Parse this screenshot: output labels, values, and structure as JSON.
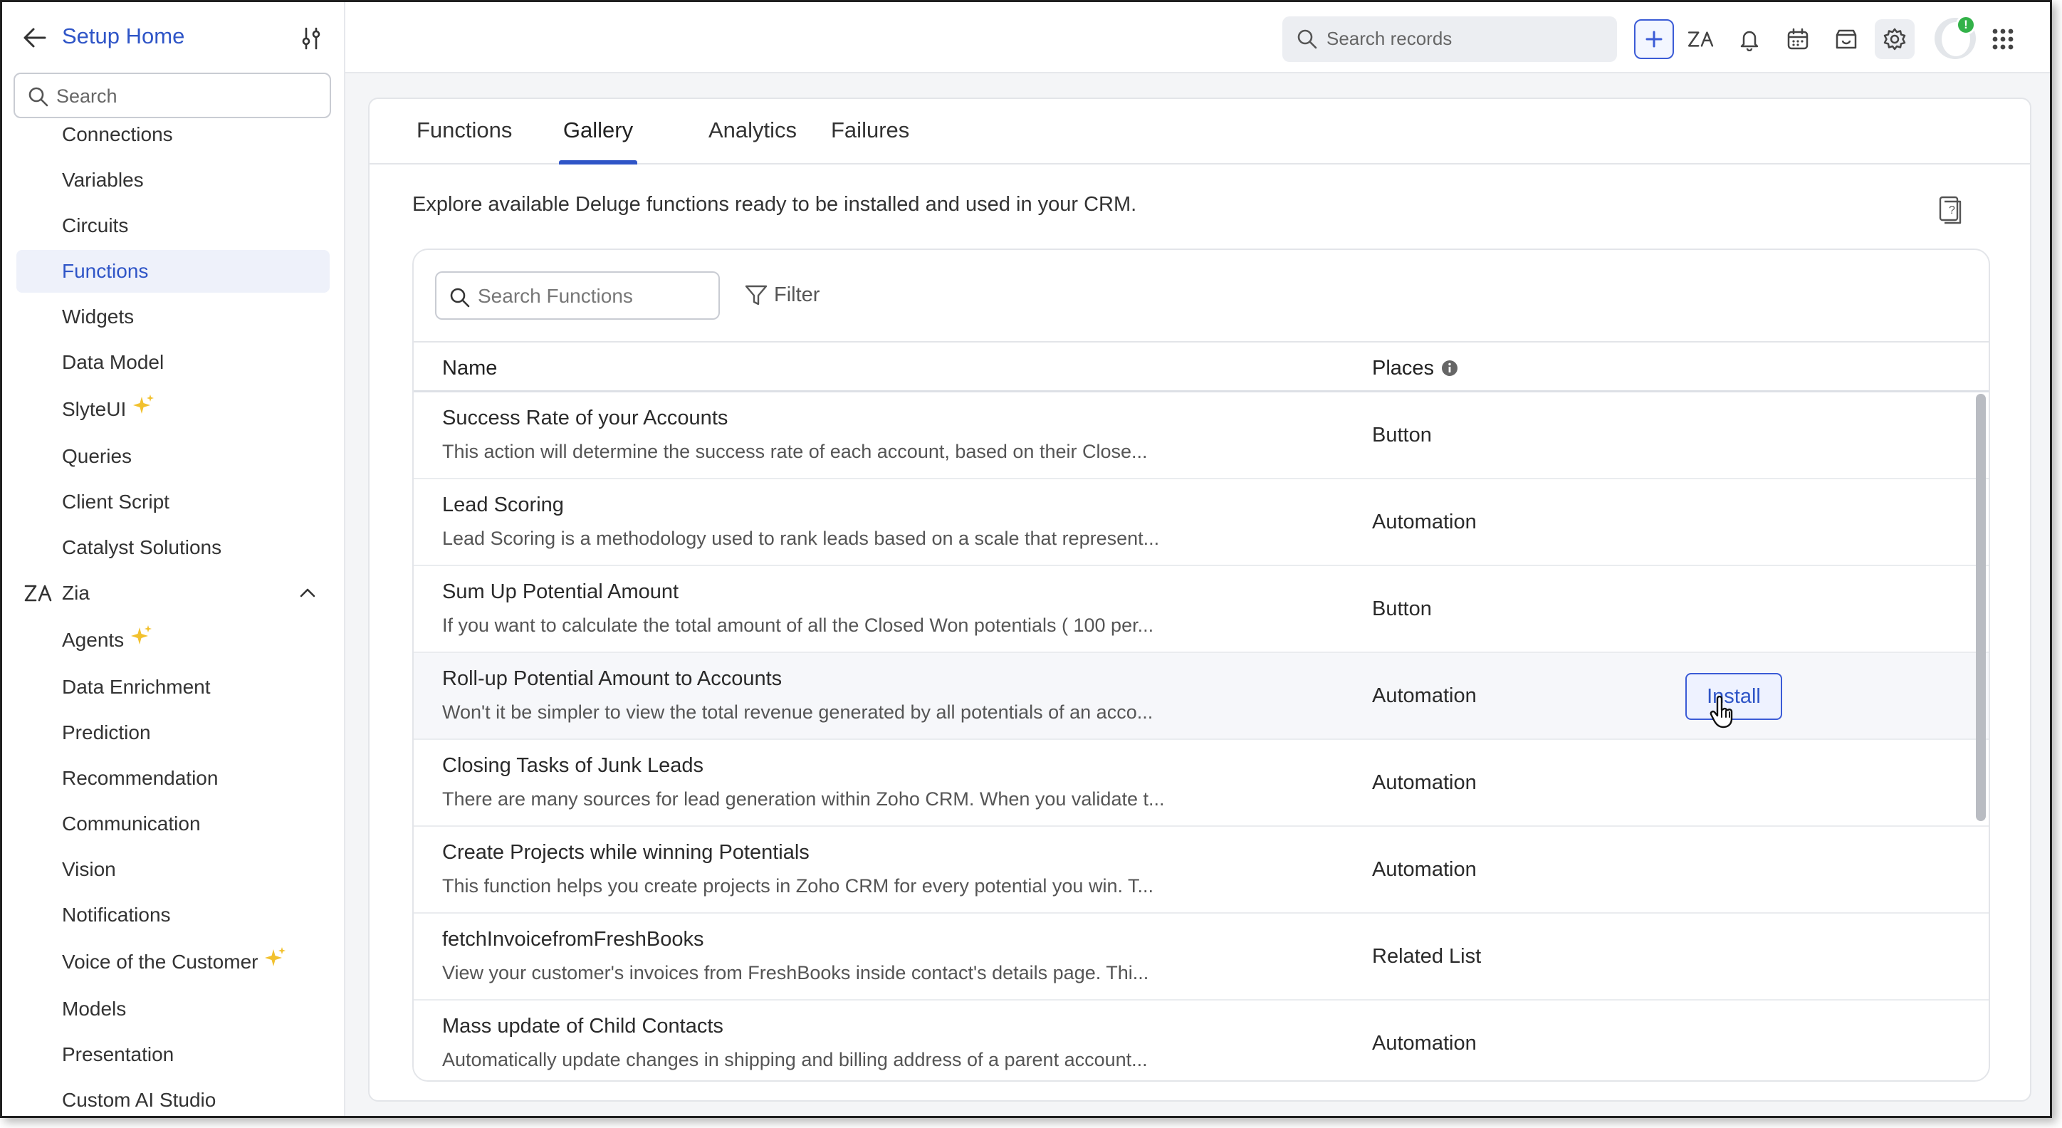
{
  "sidebar": {
    "title": "Setup Home",
    "search_placeholder": "Search",
    "items": [
      {
        "label": "Connections",
        "name": "sidebar-item-connections",
        "active": false
      },
      {
        "label": "Variables",
        "name": "sidebar-item-variables",
        "active": false
      },
      {
        "label": "Circuits",
        "name": "sidebar-item-circuits",
        "active": false
      },
      {
        "label": "Functions",
        "name": "sidebar-item-functions",
        "active": true
      },
      {
        "label": "Widgets",
        "name": "sidebar-item-widgets",
        "active": false
      },
      {
        "label": "Data Model",
        "name": "sidebar-item-data-model",
        "active": false
      },
      {
        "label": "SlyteUI",
        "name": "sidebar-item-slyteui",
        "active": false,
        "sparkle": true
      },
      {
        "label": "Queries",
        "name": "sidebar-item-queries",
        "active": false
      },
      {
        "label": "Client Script",
        "name": "sidebar-item-client-script",
        "active": false
      },
      {
        "label": "Catalyst Solutions",
        "name": "sidebar-item-catalyst-solutions",
        "active": false
      }
    ],
    "zia_section": {
      "label": "Zia",
      "expanded": true
    },
    "zia_items": [
      {
        "label": "Agents",
        "name": "sidebar-item-agents",
        "sparkle": true
      },
      {
        "label": "Data Enrichment",
        "name": "sidebar-item-data-enrichment"
      },
      {
        "label": "Prediction",
        "name": "sidebar-item-prediction"
      },
      {
        "label": "Recommendation",
        "name": "sidebar-item-recommendation"
      },
      {
        "label": "Communication",
        "name": "sidebar-item-communication"
      },
      {
        "label": "Vision",
        "name": "sidebar-item-vision"
      },
      {
        "label": "Notifications",
        "name": "sidebar-item-notifications"
      },
      {
        "label": "Voice of the Customer",
        "name": "sidebar-item-voice-of-the-customer",
        "sparkle": true
      },
      {
        "label": "Models",
        "name": "sidebar-item-models"
      },
      {
        "label": "Presentation",
        "name": "sidebar-item-presentation"
      },
      {
        "label": "Custom AI Studio",
        "name": "sidebar-item-custom-ai-studio"
      }
    ]
  },
  "topbar": {
    "search_placeholder": "Search records",
    "icons": [
      "plus-icon",
      "zia-icon",
      "bell-icon",
      "calendar-icon",
      "marketplace-icon",
      "gear-icon",
      "avatar",
      "apps-grid-icon"
    ],
    "notification_badge": "!"
  },
  "tabs": [
    {
      "label": "Functions",
      "active": false
    },
    {
      "label": "Gallery",
      "active": true
    },
    {
      "label": "Analytics",
      "active": false
    },
    {
      "label": "Failures",
      "active": false
    }
  ],
  "gallery": {
    "intro": "Explore available Deluge functions ready to be installed and used in your CRM.",
    "search_placeholder": "Search Functions",
    "filter_label": "Filter",
    "columns": {
      "name": "Name",
      "places": "Places"
    },
    "rows": [
      {
        "name": "Success Rate of your Accounts",
        "desc": "This action will determine the success rate of each account, based on their Close...",
        "place": "Button"
      },
      {
        "name": "Lead Scoring",
        "desc": "Lead Scoring is a methodology used to rank leads based on a scale that represent...",
        "place": "Automation"
      },
      {
        "name": "Sum Up Potential Amount",
        "desc": "If you want to calculate the total amount of all the Closed Won potentials ( 100 per...",
        "place": "Button"
      },
      {
        "name": "Roll-up Potential Amount to Accounts",
        "desc": "Won't it be simpler to view the total revenue generated by all potentials of an acco...",
        "place": "Automation",
        "install": "Install"
      },
      {
        "name": "Closing Tasks of Junk Leads",
        "desc": "There are many sources for lead generation within Zoho CRM. When you validate t...",
        "place": "Automation"
      },
      {
        "name": "Create Projects while winning Potentials",
        "desc": "This function helps you create projects in Zoho CRM for every potential you win. T...",
        "place": "Automation"
      },
      {
        "name": "fetchInvoicefromFreshBooks",
        "desc": "View your customer's invoices from FreshBooks inside contact's details page. Thi...",
        "place": "Related List"
      },
      {
        "name": "Mass update of Child Contacts",
        "desc": "Automatically update changes in shipping and billing address of a parent account...",
        "place": "Automation"
      }
    ]
  },
  "colors": {
    "accent": "#2f55c7",
    "active_bg": "#eef1fa",
    "sparkle": "#f2c12e",
    "badge": "#33b249"
  }
}
